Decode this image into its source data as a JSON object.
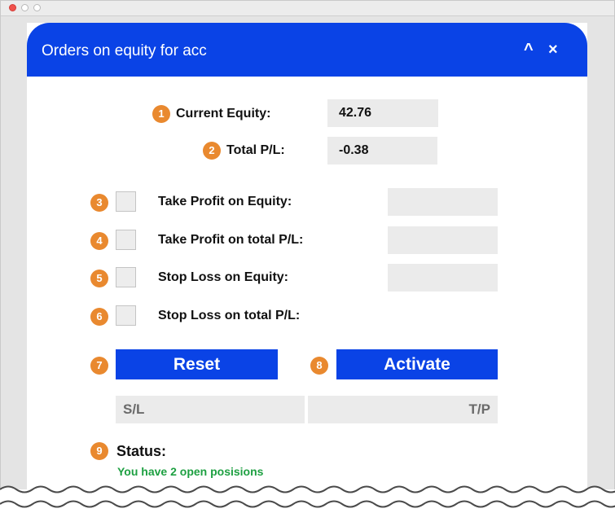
{
  "panel": {
    "title": "Orders on equity for acc",
    "collapse_icon": "chevron-up-icon",
    "close_icon": "close-icon",
    "collapse_glyph": "^",
    "close_glyph": "×"
  },
  "badges": [
    "1",
    "2",
    "3",
    "4",
    "5",
    "6",
    "7",
    "8",
    "9"
  ],
  "current_equity": {
    "label": "Current Equity:",
    "value": "42.76"
  },
  "total_pl": {
    "label": "Total P/L:",
    "value": "-0.38"
  },
  "options": [
    {
      "label": "Take Profit on Equity:",
      "checked": false,
      "value": ""
    },
    {
      "label": "Take Profit on total P/L:",
      "checked": false,
      "value": ""
    },
    {
      "label": "Stop Loss on Equity:",
      "checked": false,
      "value": ""
    },
    {
      "label": "Stop Loss on total P/L:",
      "checked": false
    }
  ],
  "buttons": {
    "reset": "Reset",
    "activate": "Activate"
  },
  "sl_tp": {
    "sl": "S/L",
    "tp": "T/P"
  },
  "status": {
    "title": "Status:",
    "text": "You have 2 open posisions"
  },
  "colors": {
    "accent": "#0a43e6",
    "badge": "#e9892f",
    "status_text": "#1ea042",
    "field_bg": "#ebebeb"
  }
}
